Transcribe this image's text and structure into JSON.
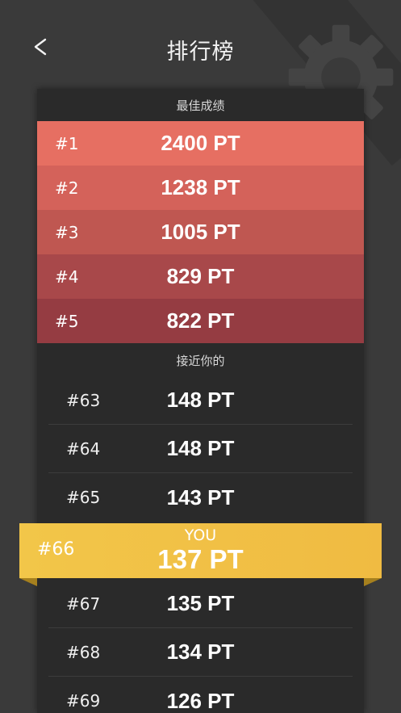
{
  "header": {
    "title": "排行榜",
    "back_icon": "chevron-left-icon"
  },
  "background": {
    "gear_icon": "gear-icon"
  },
  "colors": {
    "background": "#3a3a3a",
    "panel": "#2a2a2a",
    "top_rows": [
      "#e66f62",
      "#d4625a",
      "#bf5751",
      "#a8484a",
      "#953c42"
    ],
    "you_highlight": "#f2c649"
  },
  "best_scores": {
    "label": "最佳成绩",
    "rows": [
      {
        "rank": "#1",
        "score": "2400 PT"
      },
      {
        "rank": "#2",
        "score": "1238 PT"
      },
      {
        "rank": "#3",
        "score": "1005 PT"
      },
      {
        "rank": "#4",
        "score": "829 PT"
      },
      {
        "rank": "#5",
        "score": "822 PT"
      }
    ]
  },
  "near_you": {
    "label": "接近你的",
    "rows": [
      {
        "rank": "#63",
        "score": "148 PT"
      },
      {
        "rank": "#64",
        "score": "148 PT"
      },
      {
        "rank": "#65",
        "score": "143 PT"
      }
    ],
    "you": {
      "rank": "#66",
      "label": "YOU",
      "score": "137 PT"
    },
    "rows_after": [
      {
        "rank": "#67",
        "score": "135 PT"
      },
      {
        "rank": "#68",
        "score": "134 PT"
      },
      {
        "rank": "#69",
        "score": "126 PT"
      }
    ]
  }
}
